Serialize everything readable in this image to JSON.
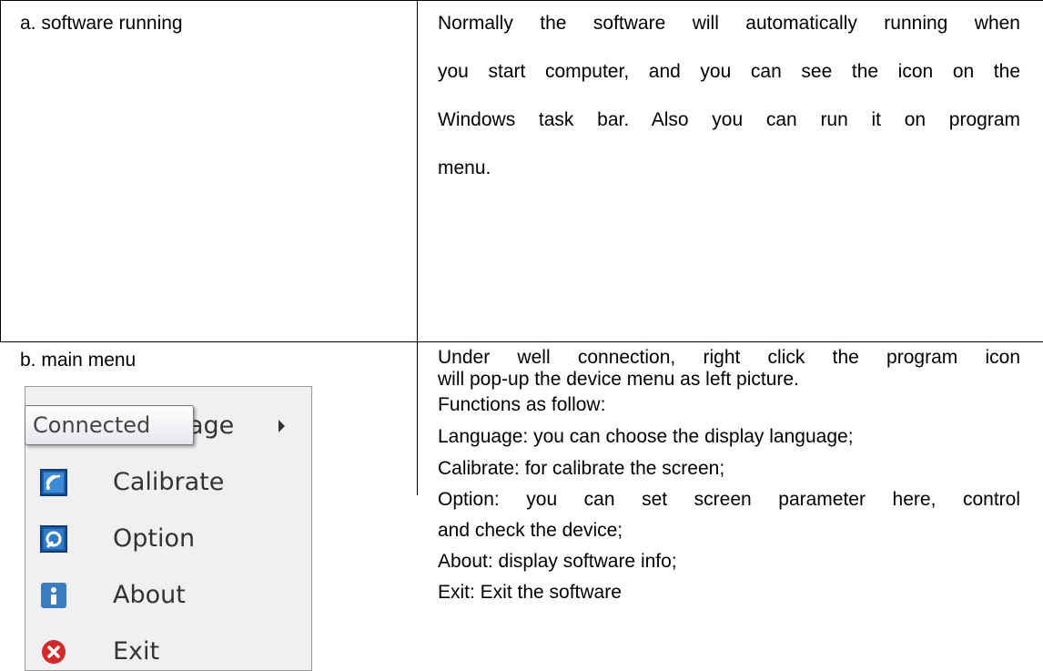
{
  "row_a": {
    "label": "a.   software running",
    "lines": [
      "Normally the software will automatically running when",
      "you start computer, and you can see the icon on the",
      "Windows task bar. Also you can run it on program",
      "menu."
    ]
  },
  "row_b": {
    "label": "b.   main menu",
    "lines": [
      "Under well connection, right click the program icon",
      "will pop-up the device menu as left picture.",
      "Functions as follow:",
      "Language: you can choose the display language;",
      "Calibrate: for calibrate the screen;",
      "Option: you can set screen parameter here, control",
      "and check the device;",
      "About: display software info;",
      "Exit: Exit the software"
    ]
  },
  "menu": {
    "items": [
      {
        "label": "Language",
        "icon": "globe-icon"
      },
      {
        "label": "Calibrate",
        "icon": "calibrate-icon"
      },
      {
        "label": "Option",
        "icon": "option-icon"
      },
      {
        "label": "About",
        "icon": "about-icon"
      },
      {
        "label": "Exit",
        "icon": "exit-icon"
      }
    ],
    "tooltip": "Connected"
  }
}
